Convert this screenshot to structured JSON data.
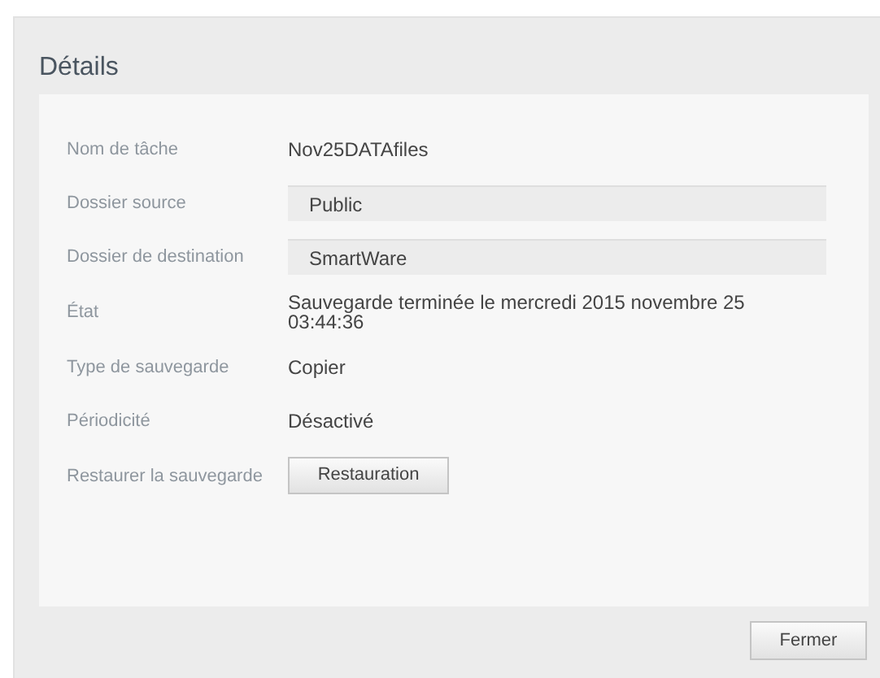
{
  "dialog": {
    "title": "Détails",
    "rows": [
      {
        "label": "Nom de tâche",
        "kind": "text",
        "value": "Nov25DATAfiles"
      },
      {
        "label": "Dossier source",
        "kind": "field",
        "value": "Public"
      },
      {
        "label": "Dossier de destination",
        "kind": "field",
        "value": "SmartWare"
      },
      {
        "label": "État",
        "kind": "text",
        "value": "Sauvegarde terminée le mercredi 2015 novembre 25 03:44:36"
      },
      {
        "label": "Type de sauvegarde",
        "kind": "text",
        "value": "Copier"
      },
      {
        "label": "Périodicité",
        "kind": "text",
        "value": "Désactivé"
      },
      {
        "label": "Restaurer la sauvegarde",
        "kind": "button",
        "value": "Restauration"
      }
    ],
    "buttons": [
      "Fermer"
    ]
  }
}
